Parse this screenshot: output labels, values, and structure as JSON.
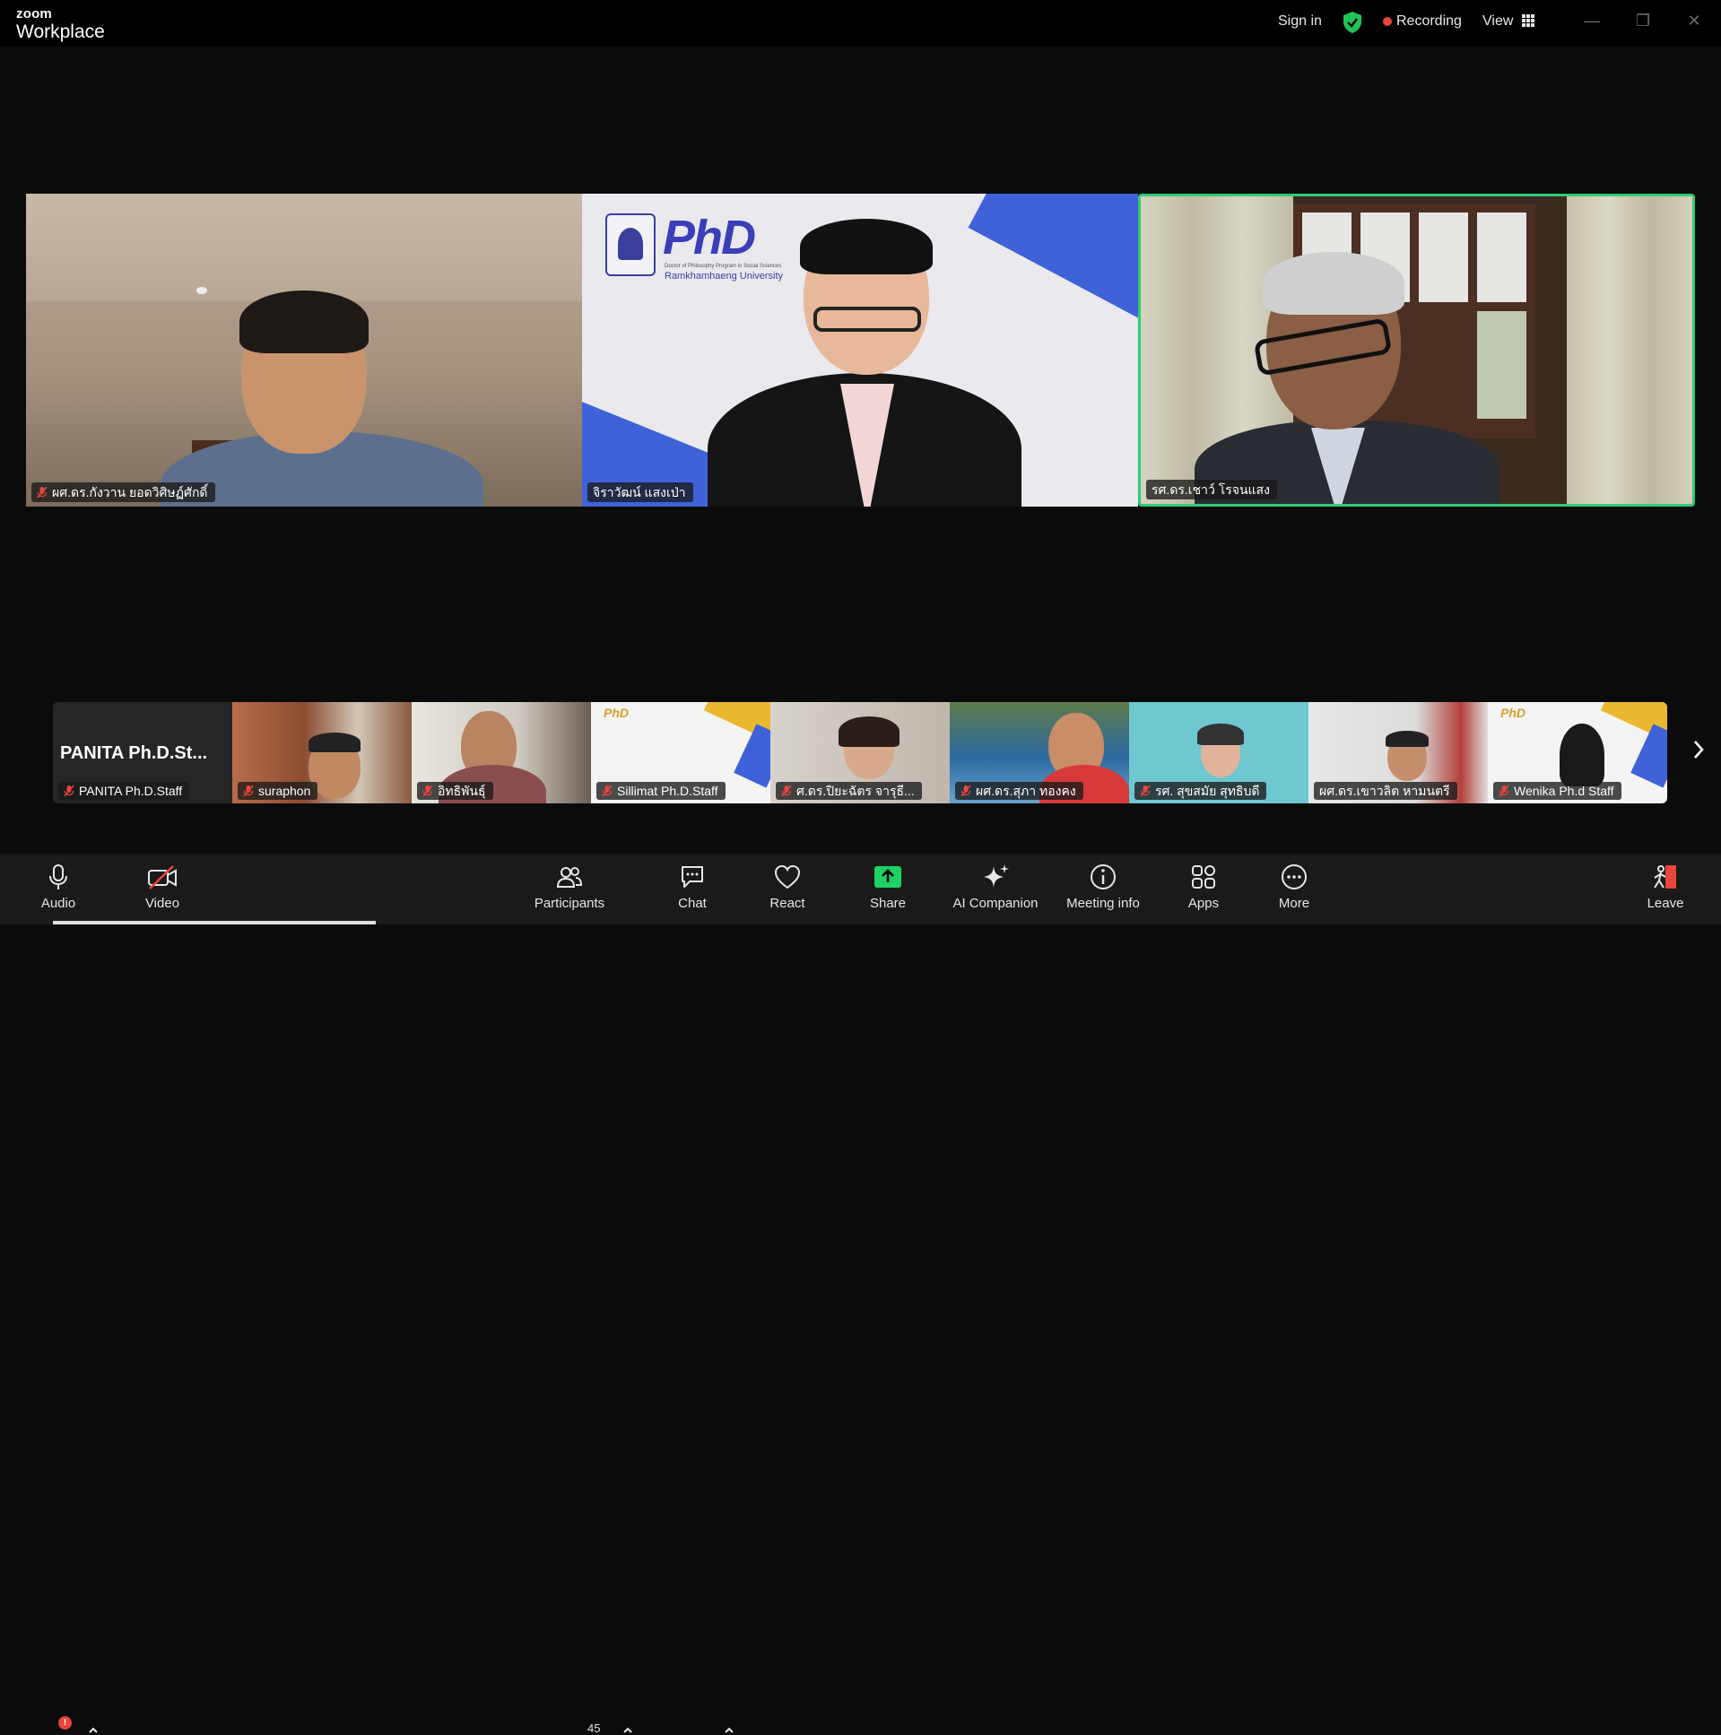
{
  "app": {
    "brand_top": "zoom",
    "brand_bottom": "Workplace"
  },
  "titlebar": {
    "signin": "Sign in",
    "recording": "Recording",
    "view": "View"
  },
  "main_tiles": [
    {
      "name": "ผศ.ดร.กังวาน  ยอดวิศิษฏ์ศักดิ์",
      "muted": true
    },
    {
      "name": "จิราวัฒน์ แสงเป่า",
      "muted": false
    },
    {
      "name": "รศ.ดร.เชาว์ โรจนแสง",
      "muted": false,
      "active_speaker": true
    }
  ],
  "tile2_branding": {
    "logo_text": "PhD",
    "line1": "Doctor of Philosophy Program in Social Sciences",
    "line2": "Ramkhamhaeng University"
  },
  "thumbnails": [
    {
      "display": "PANITA  Ph.D.St...",
      "name": "PANITA Ph.D.Staff"
    },
    {
      "name": "suraphon"
    },
    {
      "name": "อิทธิพันธุ์"
    },
    {
      "name": "Sillimat Ph.D.Staff",
      "phd_logo": "PhD"
    },
    {
      "name": "ศ.ดร.ปิยะฉัตร  จารุธี..."
    },
    {
      "name": "ผศ.ดร.สุภา  ทองคง"
    },
    {
      "name": "รศ. สุขสมัย สุทธิบดี"
    },
    {
      "name": "ผศ.ดร.เขาวลิต  หามนตรี"
    },
    {
      "name": "Wenika Ph.d Staff",
      "phd_logo": "PhD"
    }
  ],
  "toolbar": {
    "audio": "Audio",
    "audio_badge": "!",
    "video": "Video",
    "participants": "Participants",
    "participants_count": "45",
    "chat": "Chat",
    "react": "React",
    "share": "Share",
    "ai_companion": "AI Companion",
    "meeting_info": "Meeting info",
    "apps": "Apps",
    "more": "More",
    "leave": "Leave"
  },
  "colors": {
    "active_speaker": "#2ecc71",
    "recording_dot": "#e8453c",
    "share_green": "#1fd163",
    "leave_red": "#e8453c"
  }
}
